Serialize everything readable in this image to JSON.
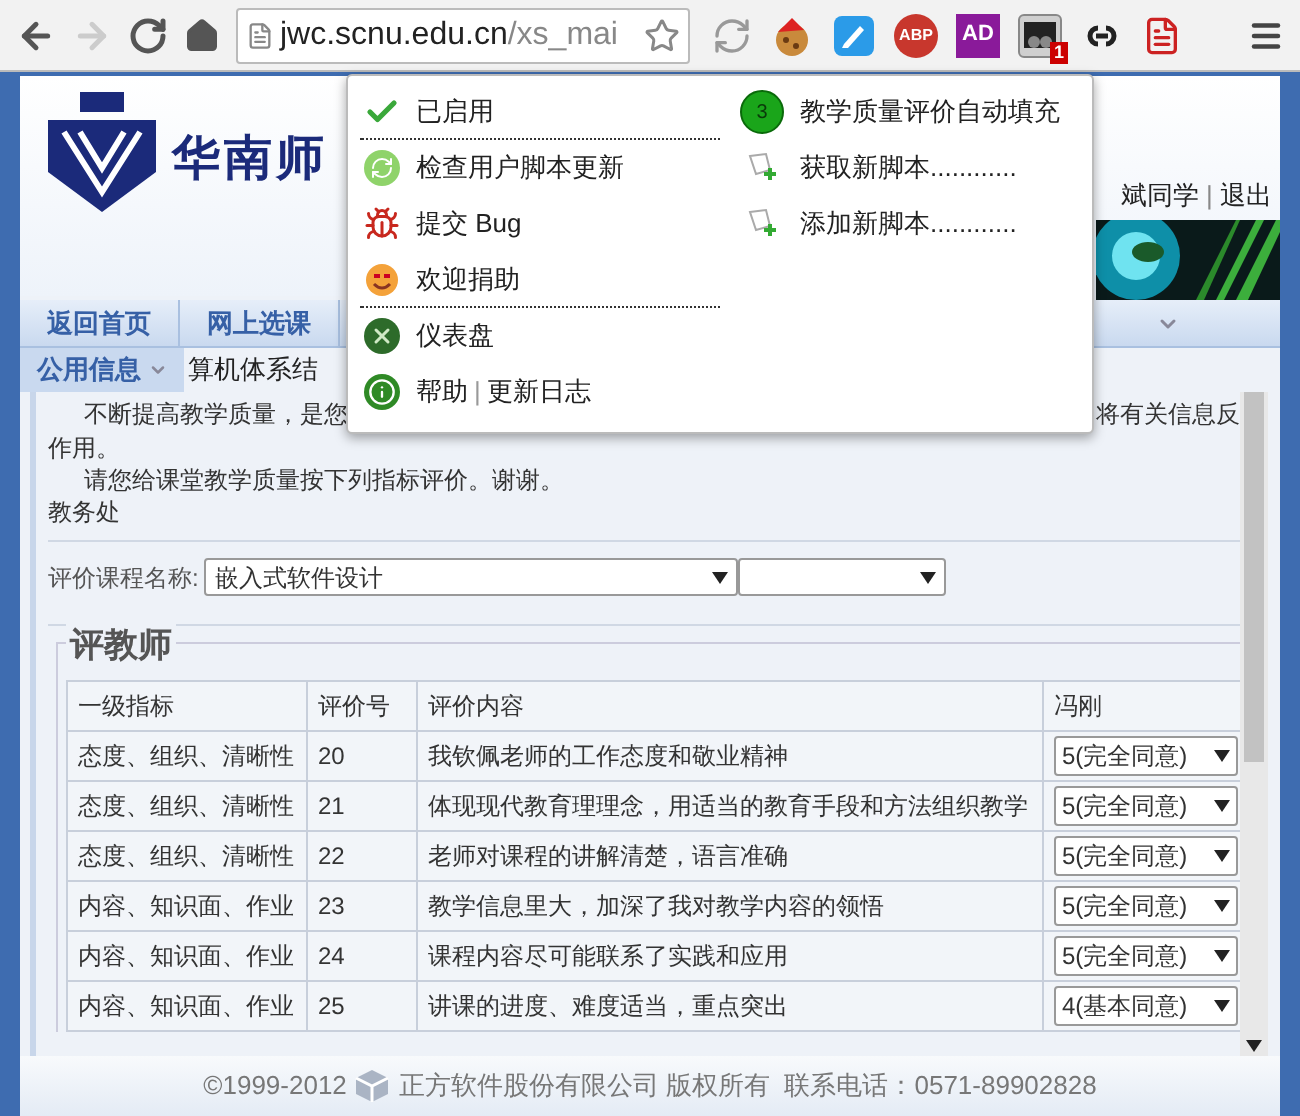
{
  "toolbar": {
    "url_host": "jwc.scnu.edu.cn",
    "url_path": "/xs_mai",
    "forward_disabled": true
  },
  "extensions": [
    {
      "kind": "sync"
    },
    {
      "kind": "cookie"
    },
    {
      "kind": "pencil"
    },
    {
      "kind": "abp",
      "label": "ABP"
    },
    {
      "kind": "ad",
      "label": "AD"
    },
    {
      "kind": "userscript",
      "badge": "1",
      "selected": true
    },
    {
      "kind": "link"
    },
    {
      "kind": "pdf"
    }
  ],
  "header": {
    "school": "华南师",
    "user": "斌同学",
    "separator": "|",
    "logout": "退出"
  },
  "nav": {
    "tabs": [
      {
        "label": "返回首页"
      },
      {
        "label": "网上选课"
      }
    ],
    "row2_tab": "公用信息",
    "course_title": "算机体系结"
  },
  "notice": {
    "line1_left": "不断提高教学质量，是您",
    "line1_right": "将有关信息反",
    "line2": "作用。",
    "line3": "请您给课堂教学质量按下列指标评价。谢谢。",
    "signature": "教务处"
  },
  "course_select": {
    "label": "评价课程名称:",
    "value": "嵌入式软件设计"
  },
  "evaluation": {
    "legend": "评教师",
    "columns": [
      "一级指标",
      "评价号",
      "评价内容",
      "冯刚"
    ],
    "rows": [
      {
        "category": "态度、组织、清晰性",
        "number": "20",
        "content": "我钦佩老师的工作态度和敬业精神",
        "rating": "5(完全同意)"
      },
      {
        "category": "态度、组织、清晰性",
        "number": "21",
        "content": "体现现代教育理理念，用适当的教育手段和方法组织教学",
        "rating": "5(完全同意)"
      },
      {
        "category": "态度、组织、清晰性",
        "number": "22",
        "content": "老师对课程的讲解清楚，语言准确",
        "rating": "5(完全同意)"
      },
      {
        "category": "内容、知识面、作业",
        "number": "23",
        "content": "教学信息里大，加深了我对教学内容的领悟",
        "rating": "5(完全同意)"
      },
      {
        "category": "内容、知识面、作业",
        "number": "24",
        "content": "课程内容尽可能联系了实践和应用",
        "rating": "5(完全同意)"
      },
      {
        "category": "内容、知识面、作业",
        "number": "25",
        "content": "讲课的进度、难度适当，重点突出",
        "rating": "4(基本同意)"
      }
    ]
  },
  "footer": {
    "copyright": "©1999-2012",
    "text": "正方软件股份有限公司 版权所有  联系电话：0571-89902828"
  },
  "popup": {
    "left_items": [
      {
        "kind": "check",
        "label": "已启用",
        "divider_after": true
      },
      {
        "kind": "refresh",
        "label": "检查用户脚本更新",
        "divider_after": false
      },
      {
        "kind": "bug",
        "label": "提交 Bug",
        "divider_after": false
      },
      {
        "kind": "donate",
        "label": "欢迎捐助",
        "divider_after": true
      },
      {
        "kind": "dashboard",
        "label": "仪表盘",
        "divider_after": false
      },
      {
        "kind": "help",
        "label": "帮助",
        "separator": "|",
        "link": "更新日志",
        "divider_after": false
      }
    ],
    "right_items": [
      {
        "kind": "script",
        "label": "教学质量评价自动填充",
        "count": "3"
      },
      {
        "kind": "get",
        "label": "获取新脚本............"
      },
      {
        "kind": "add",
        "label": "添加新脚本............"
      }
    ]
  }
}
